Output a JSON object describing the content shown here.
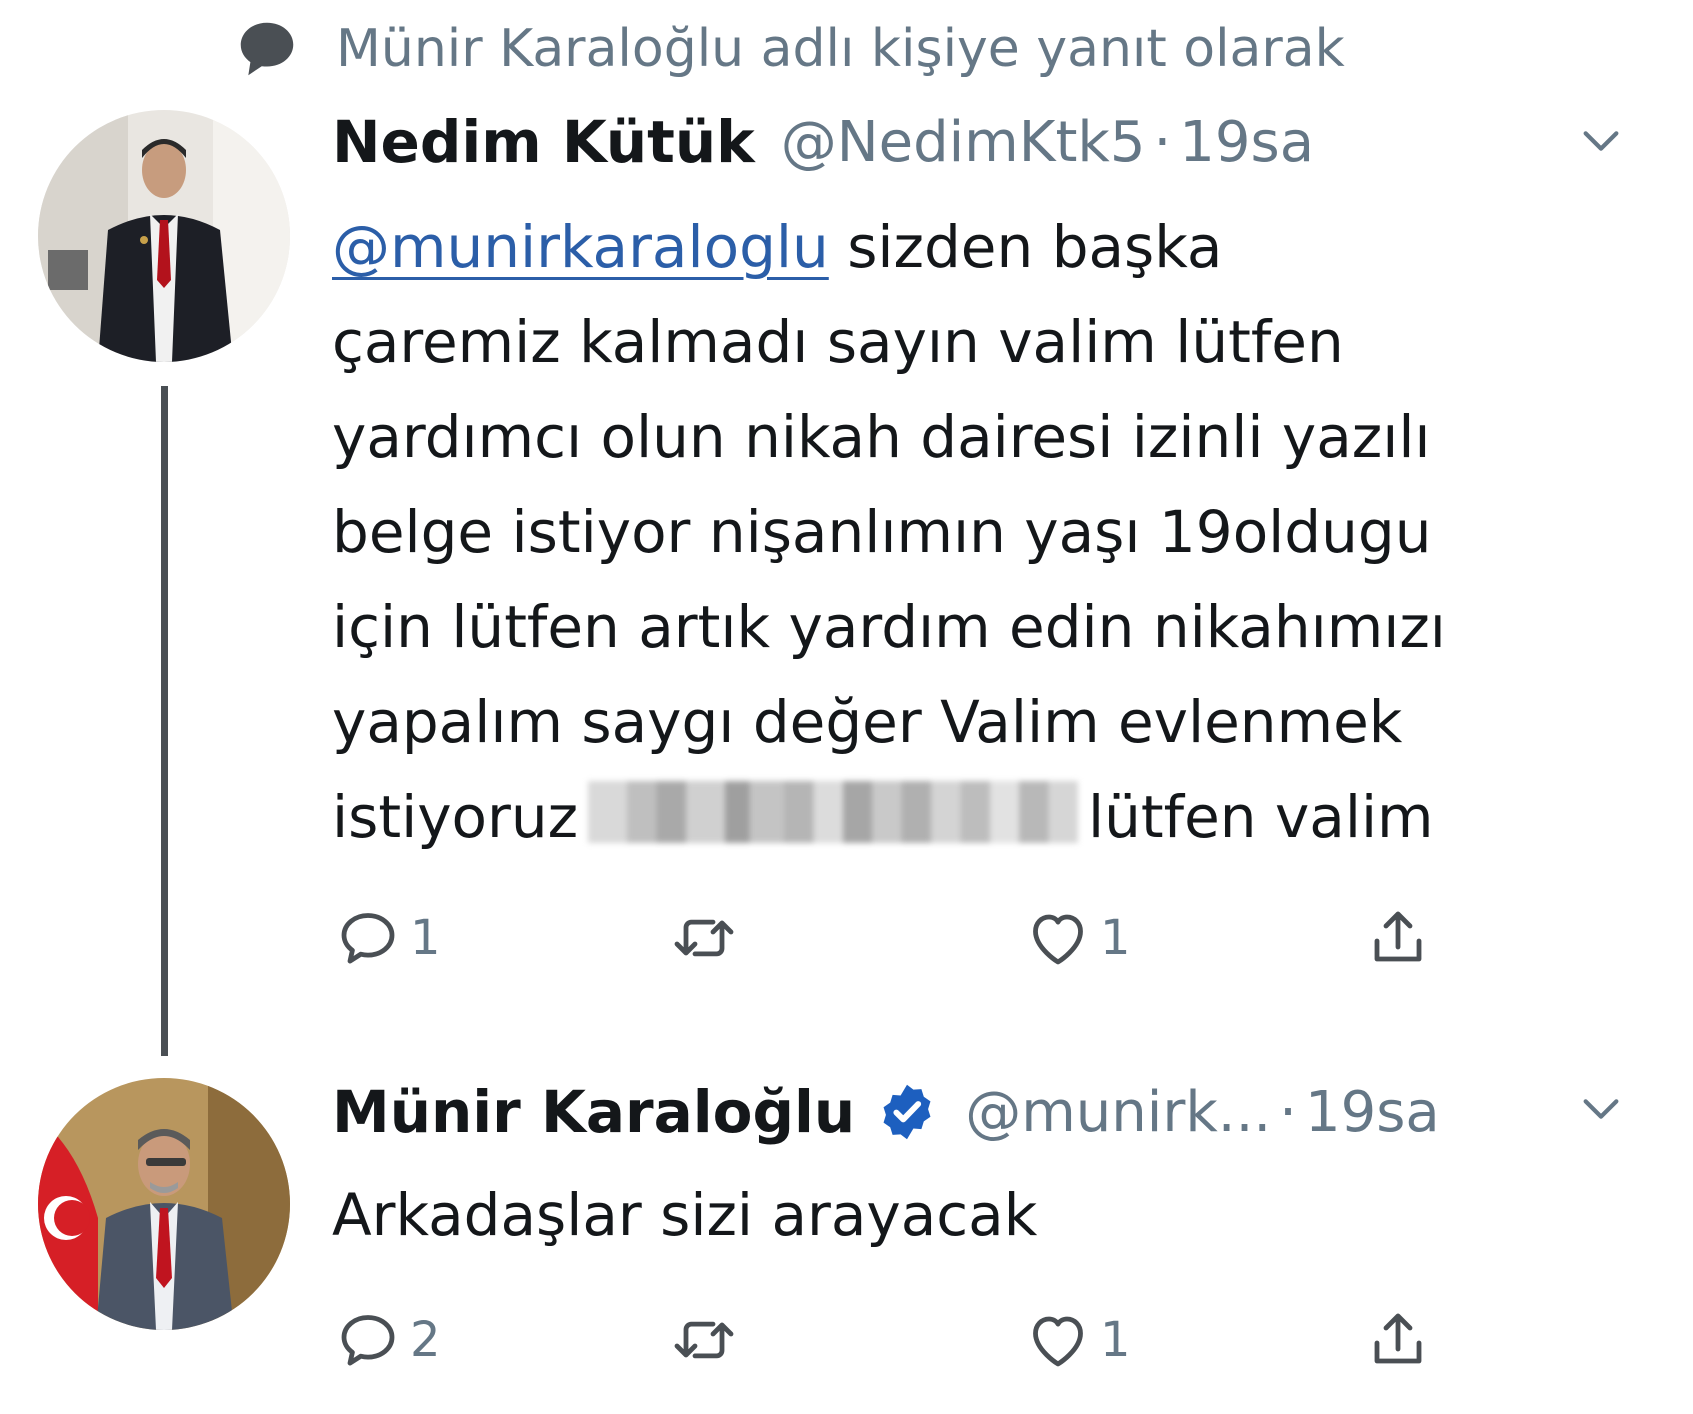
{
  "reply_context": {
    "icon": "speech-bubble-icon",
    "text": "Münir Karaloğlu adlı kişiye yanıt olarak"
  },
  "tweets": [
    {
      "author_name": "Nedim Kütük",
      "handle": "@NedimKtk5",
      "separator": "·",
      "time": "19sa",
      "verified": false,
      "text_lines": {
        "mention": "@munirkaraloglu",
        "line0_rest": " sizden başka",
        "line1": "çaremiz kalmadı sayın valim lütfen",
        "line2": "yardımcı olun nikah dairesi izinli yazılı",
        "line3": "belge istiyor nişanlımın yaşı 19oldugu",
        "line4": "için lütfen artık yardım edin nikahımızı",
        "line5": "yapalım saygı değer Valim evlenmek",
        "line6_start": "istiyoruz",
        "line6_end": "lütfen valim"
      },
      "counts": {
        "replies": "1",
        "retweets": "",
        "likes": "1"
      }
    },
    {
      "author_name": "Münir Karaloğlu",
      "handle": "@munirk...",
      "separator": "·",
      "time": "19sa",
      "verified": true,
      "text": "Arkadaşlar sizi arayacak",
      "counts": {
        "replies": "2",
        "retweets": "",
        "likes": "1"
      }
    }
  ],
  "icons": {
    "reply": "reply-icon",
    "retweet": "retweet-icon",
    "like": "heart-icon",
    "share": "share-icon",
    "more": "chevron-down-icon",
    "verified": "verified-badge-icon"
  },
  "colors": {
    "text": "#14171a",
    "secondary": "#657786",
    "mention": "#2b5ea8",
    "verified": "#1d5fbf",
    "thread_line": "#4a4f54"
  }
}
